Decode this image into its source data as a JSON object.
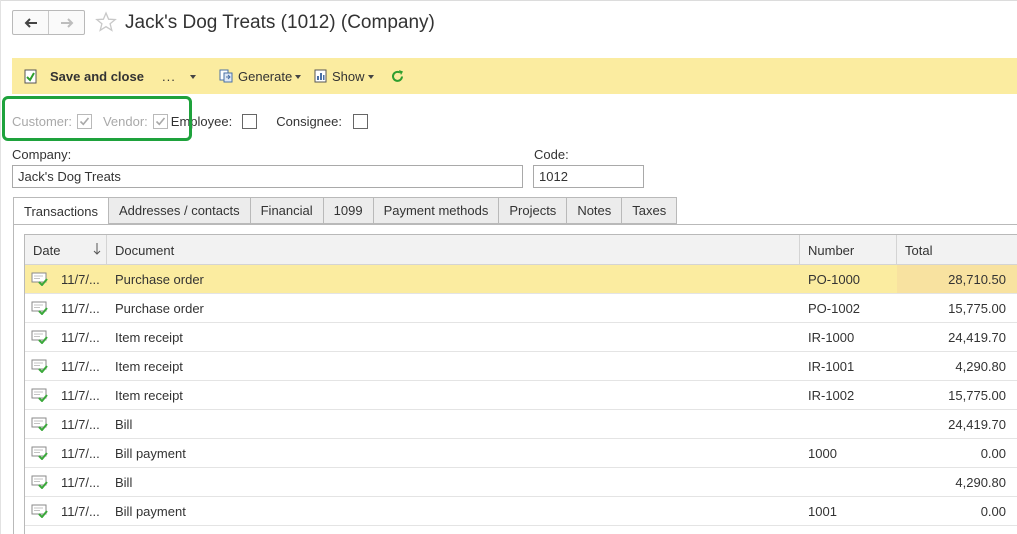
{
  "window": {
    "title": "Jack's Dog Treats (1012) (Company)"
  },
  "toolbar": {
    "save_label": "Save and close",
    "more_label": "...",
    "generate_label": "Generate",
    "show_label": "Show"
  },
  "roles": {
    "customer_label": "Customer:",
    "customer_checked": true,
    "vendor_label": "Vendor:",
    "vendor_checked": true,
    "employee_label": "Employee:",
    "employee_checked": false,
    "consignee_label": "Consignee:",
    "consignee_checked": false
  },
  "form": {
    "company_label": "Company:",
    "company_value": "Jack's Dog Treats",
    "code_label": "Code:",
    "code_value": "1012"
  },
  "tabs": [
    {
      "label": "Transactions",
      "active": true
    },
    {
      "label": "Addresses / contacts"
    },
    {
      "label": "Financial"
    },
    {
      "label": "1099"
    },
    {
      "label": "Payment methods"
    },
    {
      "label": "Projects"
    },
    {
      "label": "Notes"
    },
    {
      "label": "Taxes"
    }
  ],
  "table": {
    "columns": {
      "date": "Date",
      "document": "Document",
      "number": "Number",
      "total": "Total"
    },
    "rows": [
      {
        "date": "11/7/...",
        "document": "Purchase order",
        "number": "PO-1000",
        "total": "28,710.50"
      },
      {
        "date": "11/7/...",
        "document": "Purchase order",
        "number": "PO-1002",
        "total": "15,775.00"
      },
      {
        "date": "11/7/...",
        "document": "Item receipt",
        "number": "IR-1000",
        "total": "24,419.70"
      },
      {
        "date": "11/7/...",
        "document": "Item receipt",
        "number": "IR-1001",
        "total": "4,290.80"
      },
      {
        "date": "11/7/...",
        "document": "Item receipt",
        "number": "IR-1002",
        "total": "15,775.00"
      },
      {
        "date": "11/7/...",
        "document": "Bill",
        "number": "",
        "total": "24,419.70"
      },
      {
        "date": "11/7/...",
        "document": "Bill payment",
        "number": "1000",
        "total": "0.00"
      },
      {
        "date": "11/7/...",
        "document": "Bill",
        "number": "",
        "total": "4,290.80"
      },
      {
        "date": "11/7/...",
        "document": "Bill payment",
        "number": "1001",
        "total": "0.00"
      }
    ]
  },
  "colors": {
    "toolbar_bg": "#fbeca0",
    "highlight_border": "#1ea23c",
    "refresh_icon": "#2e9e2e",
    "posted_check": "#3aa83a"
  }
}
